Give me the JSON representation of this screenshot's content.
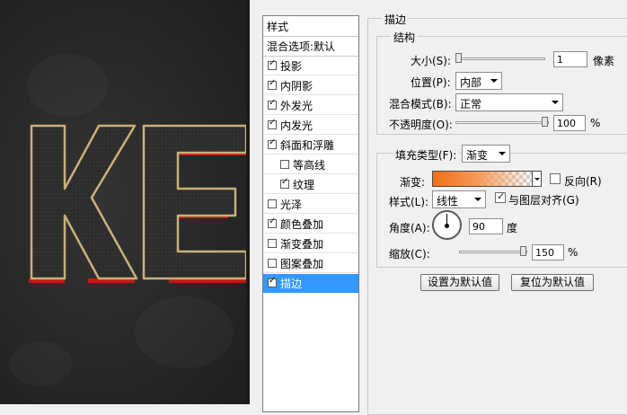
{
  "canvas": {
    "letters": [
      "K",
      "E"
    ]
  },
  "styles_list": {
    "header": "样式",
    "blend_options": "混合选项:默认",
    "items": [
      {
        "label": "投影",
        "checked": true,
        "indent": false
      },
      {
        "label": "内阴影",
        "checked": true,
        "indent": false
      },
      {
        "label": "外发光",
        "checked": true,
        "indent": false
      },
      {
        "label": "内发光",
        "checked": true,
        "indent": false
      },
      {
        "label": "斜面和浮雕",
        "checked": true,
        "indent": false
      },
      {
        "label": "等高线",
        "checked": false,
        "indent": true
      },
      {
        "label": "纹理",
        "checked": true,
        "indent": true
      },
      {
        "label": "光泽",
        "checked": false,
        "indent": false
      },
      {
        "label": "颜色叠加",
        "checked": true,
        "indent": false
      },
      {
        "label": "渐变叠加",
        "checked": false,
        "indent": false
      },
      {
        "label": "图案叠加",
        "checked": false,
        "indent": false
      },
      {
        "label": "描边",
        "checked": true,
        "indent": false,
        "selected": true
      }
    ]
  },
  "stroke": {
    "title": "描边",
    "structure": {
      "title": "结构",
      "size_label": "大小(S):",
      "size_value": "1",
      "size_unit": "像素",
      "size_slider_fraction": 0.0,
      "position_label": "位置(P):",
      "position_value": "内部",
      "blend_mode_label": "混合模式(B):",
      "blend_mode_value": "正常",
      "opacity_label": "不透明度(O):",
      "opacity_value": "100",
      "opacity_unit": "%",
      "opacity_fraction": 1.0
    },
    "fill": {
      "fill_type_label": "填充类型(F):",
      "fill_type_value": "渐变",
      "gradient_label": "渐变:",
      "reverse_label": "反向(R)",
      "reverse_checked": false,
      "style_label": "样式(L):",
      "style_value": "线性",
      "align_label": "与图层对齐(G)",
      "align_checked": true,
      "angle_label": "角度(A):",
      "angle_value": "90",
      "angle_unit": "度",
      "scale_label": "缩放(C):",
      "scale_value": "150",
      "scale_unit": "%",
      "scale_fraction": 1.0
    },
    "buttons": {
      "make_default": "设置为默认值",
      "reset_default": "复位为默认值"
    },
    "colors": {
      "gradient_start": "#f07018",
      "selection": "#3399ff"
    }
  }
}
